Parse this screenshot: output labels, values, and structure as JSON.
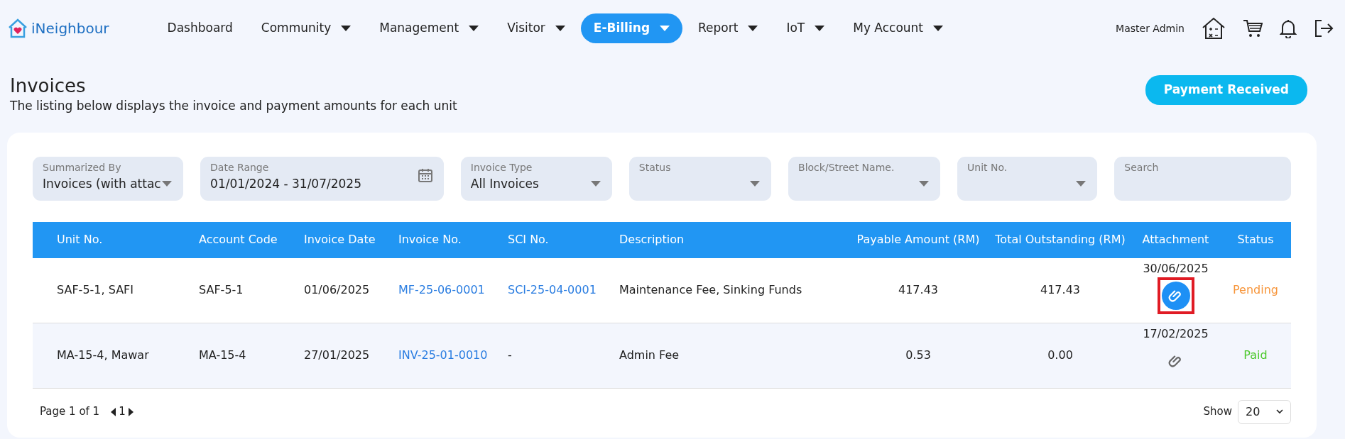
{
  "brand": {
    "name": "iNeighbour"
  },
  "nav": [
    {
      "label": "Dashboard",
      "dropdown": false,
      "selected": false
    },
    {
      "label": "Community",
      "dropdown": true,
      "selected": false
    },
    {
      "label": "Management",
      "dropdown": true,
      "selected": false
    },
    {
      "label": "Visitor",
      "dropdown": true,
      "selected": false
    },
    {
      "label": "E-Billing",
      "dropdown": true,
      "selected": true
    },
    {
      "label": "Report",
      "dropdown": true,
      "selected": false
    },
    {
      "label": "IoT",
      "dropdown": true,
      "selected": false
    },
    {
      "label": "My Account",
      "dropdown": true,
      "selected": false
    }
  ],
  "user": {
    "name": "Master Admin"
  },
  "page": {
    "title": "Invoices",
    "subtitle": "The listing below displays the invoice and payment amounts for each unit",
    "action": "Payment Received"
  },
  "filters": [
    {
      "label": "Summarized By",
      "value": "Invoices (with attac",
      "kind": "select"
    },
    {
      "label": "Date Range",
      "value": "01/01/2024 - 31/07/2025",
      "kind": "date"
    },
    {
      "label": "Invoice Type",
      "value": "All Invoices",
      "kind": "select"
    },
    {
      "label": "Status",
      "kind": "select"
    },
    {
      "label": "Block/Street Name.",
      "kind": "select"
    },
    {
      "label": "Unit No.",
      "kind": "select"
    },
    {
      "label": "Search",
      "kind": "text"
    }
  ],
  "table": {
    "columns": [
      "Unit No.",
      "Account Code",
      "Invoice Date",
      "Invoice No.",
      "SCI No.",
      "Description",
      "Payable Amount (RM)",
      "Total Outstanding (RM)",
      "Attachment",
      "Status"
    ],
    "rows": [
      {
        "unit": "SAF-5-1, SAFI",
        "account": "SAF-5-1",
        "date": "01/06/2025",
        "invoice_no": "MF-25-06-0001",
        "sci_no": "SCI-25-04-0001",
        "sci_link": true,
        "description": "Maintenance Fee, Sinking Funds",
        "payable": "417.43",
        "outstanding": "417.43",
        "attachment_date": "30/06/2025",
        "attachment_highlighted": true,
        "status": "Pending",
        "color": "#f7953a"
      },
      {
        "unit": "MA-15-4, Mawar",
        "account": "MA-15-4",
        "date": "27/01/2025",
        "invoice_no": "INV-25-01-0010",
        "sci_no": "-",
        "sci_link": false,
        "description": "Admin Fee",
        "payable": "0.53",
        "outstanding": "0.00",
        "attachment_date": "17/02/2025",
        "attachment_highlighted": false,
        "status": "Paid",
        "color": "#4cc92c"
      }
    ]
  },
  "pagination": {
    "info": "Page 1 of 1",
    "pages": [
      "1"
    ],
    "show_label": "Show",
    "page_size": "20"
  }
}
